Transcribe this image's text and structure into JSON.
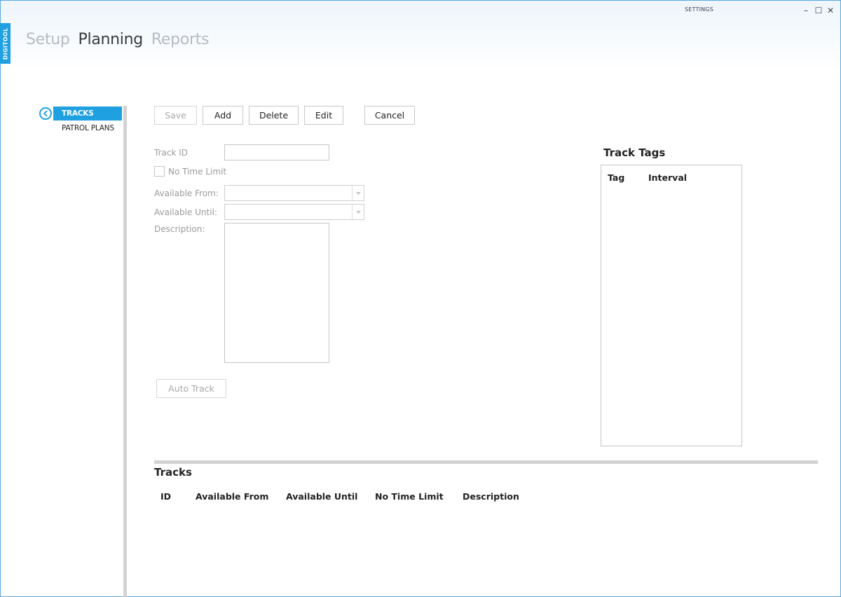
{
  "app": {
    "badge": "DIGITOOL",
    "window_title": "SETTINGS",
    "window_controls": {
      "minimize": "–",
      "maximize": "☐",
      "close": "✕"
    }
  },
  "nav": {
    "items": [
      {
        "label": "Setup",
        "active": false
      },
      {
        "label": "Planning",
        "active": true
      },
      {
        "label": "Reports",
        "active": false
      }
    ]
  },
  "sidebar": {
    "back_icon": "chevron-left-circle-icon",
    "items": [
      {
        "label": "TRACKS",
        "selected": true
      },
      {
        "label": "PATROL PLANS",
        "selected": false
      }
    ]
  },
  "toolbar": {
    "save_label": "Save",
    "add_label": "Add",
    "delete_label": "Delete",
    "edit_label": "Edit",
    "cancel_label": "Cancel"
  },
  "form": {
    "track_id_label": "Track ID",
    "track_id_value": "",
    "no_time_limit_label": "No Time Limit",
    "no_time_limit_checked": false,
    "available_from_label": "Available From:",
    "available_from_value": "",
    "available_until_label": "Available Until:",
    "available_until_value": "",
    "description_label": "Description:",
    "description_value": "",
    "auto_track_label": "Auto Track"
  },
  "track_tags": {
    "title": "Track Tags",
    "columns": [
      "Tag",
      "Interval"
    ],
    "rows": []
  },
  "tracks": {
    "title": "Tracks",
    "columns": [
      "ID",
      "Available From",
      "Available Until",
      "No Time Limit",
      "Description"
    ],
    "rows": []
  },
  "colors": {
    "accent": "#1ea0e1",
    "nav_inactive": "#b6bcc3",
    "nav_active": "#3a3a3a",
    "disabled_text": "#a9a9a9",
    "divider": "#d3d3d3"
  }
}
